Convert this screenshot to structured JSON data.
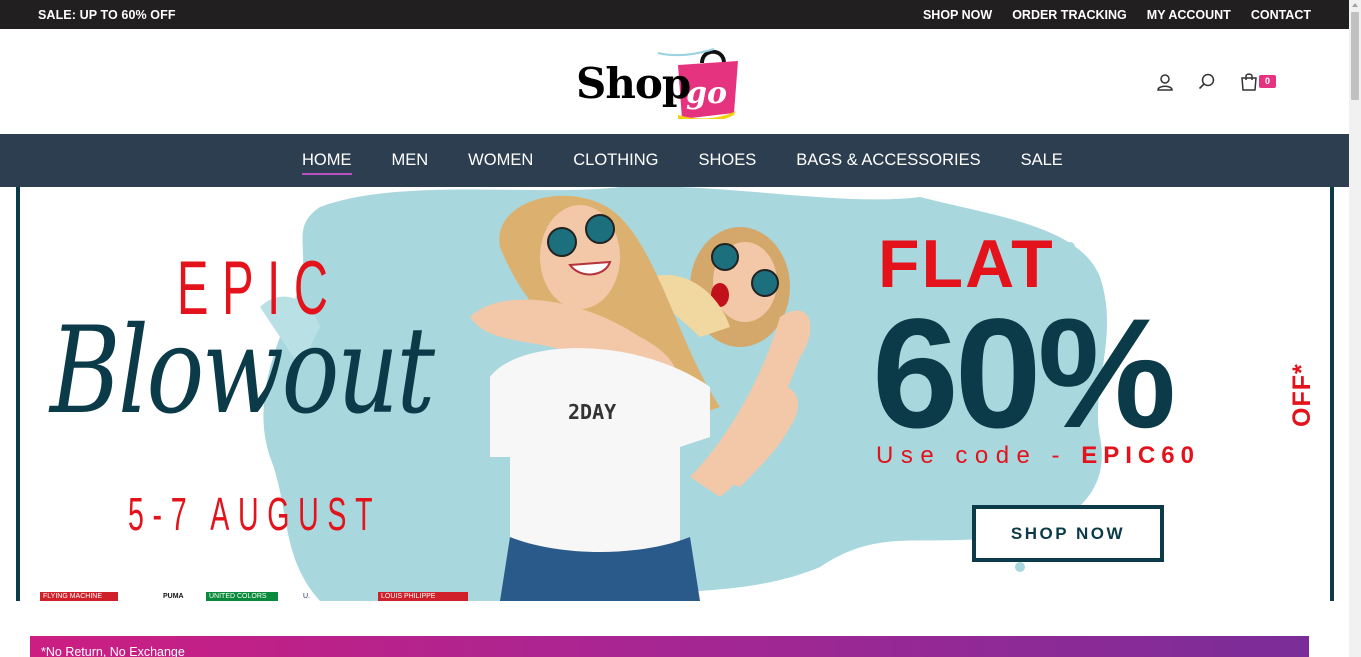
{
  "topbar": {
    "sale_text": "SALE: UP TO 60% OFF",
    "links": [
      "SHOP NOW",
      "ORDER TRACKING",
      "MY ACCOUNT",
      "CONTACT"
    ]
  },
  "header": {
    "logo_text_shop": "Shop",
    "logo_text_go": "go",
    "cart_count": "0",
    "icons": [
      "user-icon",
      "search-icon",
      "cart-icon"
    ]
  },
  "nav": {
    "items": [
      "HOME",
      "MEN",
      "WOMEN",
      "CLOTHING",
      "SHOES",
      "BAGS & ACCESSORIES",
      "SALE"
    ],
    "active": "HOME"
  },
  "hero": {
    "epic": "EPIC",
    "blowout": "Blowout",
    "dates": "5-7 AUGUST",
    "flat": "FLAT",
    "percent": "60%",
    "off": "OFF*",
    "code_prefix": "Use code - ",
    "code": "EPIC60",
    "shirt_text": "2DAY",
    "cta": "SHOP NOW",
    "brands": [
      "FLYING MACHINE",
      "PUMA",
      "UNITED COLORS OF BENETTON",
      "U.S. POLO ASSN.",
      "LOUIS PHILIPPE"
    ]
  },
  "strip": {
    "text": "*No Return, No Exchange"
  },
  "colors": {
    "topbar_bg": "#221f20",
    "nav_bg": "#2c3e50",
    "accent_red": "#e3121b",
    "accent_teal": "#0b3a48",
    "badge_pink": "#e6337f"
  }
}
